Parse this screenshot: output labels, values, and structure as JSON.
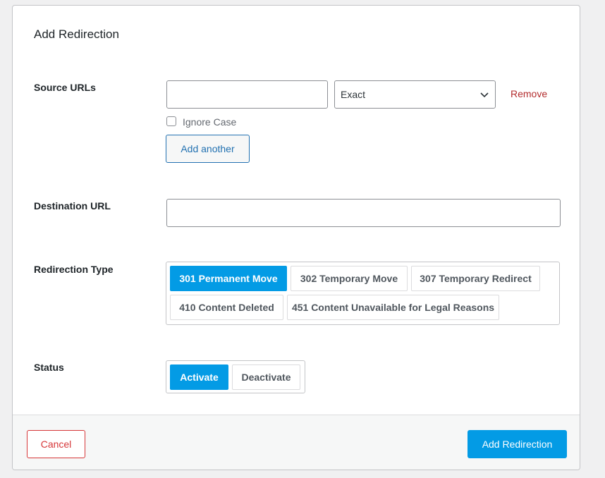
{
  "form": {
    "title": "Add Redirection"
  },
  "source": {
    "label": "Source URLs",
    "url_value": "",
    "match_value": "Exact",
    "remove_label": "Remove",
    "ignore_case_label": "Ignore Case",
    "ignore_case_checked": false,
    "add_another_label": "Add another"
  },
  "destination": {
    "label": "Destination URL",
    "value": ""
  },
  "redirection_type": {
    "label": "Redirection Type",
    "options": [
      {
        "label": "301 Permanent Move",
        "selected": true
      },
      {
        "label": "302 Temporary Move",
        "selected": false
      },
      {
        "label": "307 Temporary Redirect",
        "selected": false
      },
      {
        "label": "410 Content Deleted",
        "selected": false
      },
      {
        "label": "451 Content Unavailable for Legal Reasons",
        "selected": false
      }
    ]
  },
  "status": {
    "label": "Status",
    "options": [
      {
        "label": "Activate",
        "selected": true
      },
      {
        "label": "Deactivate",
        "selected": false
      }
    ]
  },
  "footer": {
    "cancel_label": "Cancel",
    "submit_label": "Add Redirection"
  },
  "colors": {
    "primary": "#039be5",
    "danger": "#d63638",
    "remove": "#b32d2e",
    "link": "#2271b1"
  },
  "icons": {
    "select_arrow": "chevron-down-icon"
  }
}
